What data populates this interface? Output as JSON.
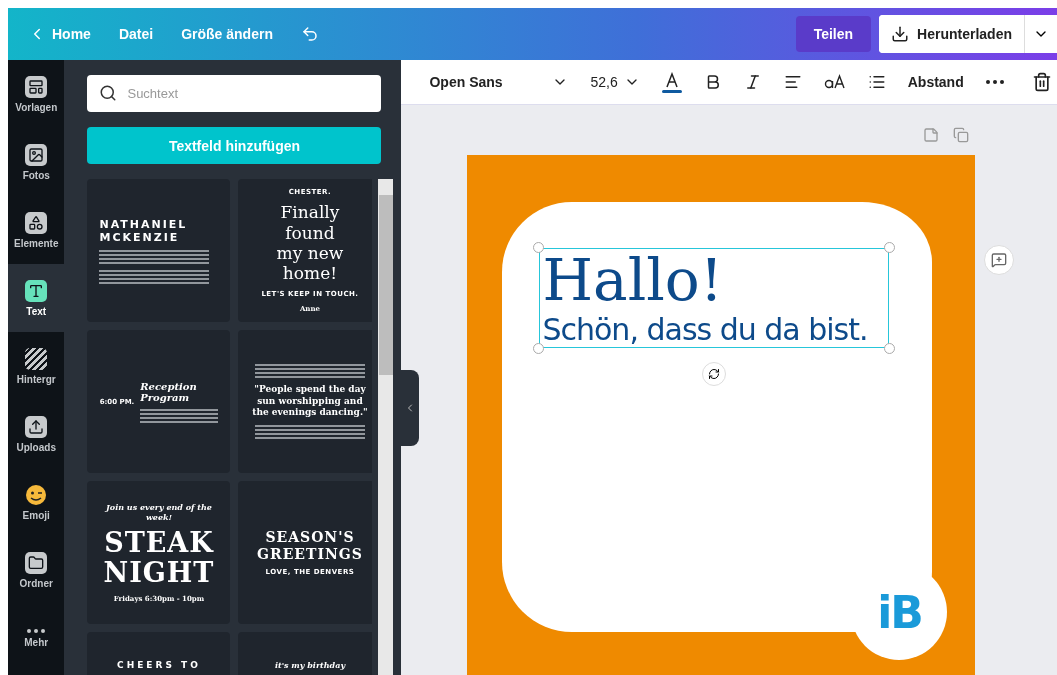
{
  "topbar": {
    "back": "Home",
    "menu": [
      "Datei",
      "Größe ändern"
    ],
    "share": "Teilen",
    "download": "Herunterladen"
  },
  "rail": [
    {
      "label": "Vorlagen",
      "selected": false
    },
    {
      "label": "Fotos",
      "selected": false
    },
    {
      "label": "Elemente",
      "selected": false
    },
    {
      "label": "Text",
      "selected": true
    },
    {
      "label": "Hintergr",
      "selected": false
    },
    {
      "label": "Uploads",
      "selected": false
    },
    {
      "label": "Emoji",
      "selected": false
    },
    {
      "label": "Ordner",
      "selected": false
    },
    {
      "label": "Mehr",
      "selected": false
    }
  ],
  "panel": {
    "search": {
      "placeholder": "Suchtext"
    },
    "add_button": "Textfeld hinzufügen",
    "templates": [
      {
        "kind": "stack",
        "lines": [
          {
            "kind": "caps",
            "text": "NATHANIEL MCKENZIE"
          },
          {
            "kind": "filler"
          },
          {
            "kind": "filler"
          }
        ]
      },
      {
        "kind": "stack",
        "lines": [
          {
            "kind": "tiny",
            "text": "CHESTER."
          },
          {
            "kind": "serif",
            "text": "Finally found my new home!"
          },
          {
            "kind": "tiny",
            "text": "LET'S KEEP IN TOUCH."
          },
          {
            "kind": "small",
            "text": "Anne"
          }
        ]
      },
      {
        "kind": "side",
        "time": "6:00 PM.",
        "lines": [
          {
            "kind": "italic",
            "text": "Reception Program"
          },
          {
            "kind": "filler"
          }
        ]
      },
      {
        "kind": "stack",
        "lines": [
          {
            "kind": "filler"
          },
          {
            "kind": "slab",
            "text": "\"People spend the day sun worshipping and the evenings dancing.\""
          },
          {
            "kind": "filler"
          }
        ]
      },
      {
        "kind": "stack",
        "lines": [
          {
            "kind": "italic-small",
            "text": "Join us every end of the week!"
          },
          {
            "kind": "block",
            "text": "STEAK NIGHT"
          },
          {
            "kind": "small",
            "text": "Fridays 6:30pm - 10pm"
          }
        ]
      },
      {
        "kind": "stack",
        "lines": [
          {
            "kind": "block-medium",
            "text": "SEASON'S GREETINGS"
          },
          {
            "kind": "tiny",
            "text": "LOVE, THE DENVERS"
          }
        ]
      },
      {
        "kind": "stack",
        "lines": [
          {
            "kind": "caps-small",
            "text": "CHEERS TO"
          }
        ]
      },
      {
        "kind": "stack",
        "lines": [
          {
            "kind": "italic-small",
            "text": "it's my birthday"
          }
        ]
      }
    ]
  },
  "toolbar": {
    "font": "Open Sans",
    "size": "52,6",
    "spacing": "Abstand"
  },
  "design": {
    "heading": "Hallo!",
    "subheading": "Schön, dass du da bist.",
    "logo": "iB"
  }
}
